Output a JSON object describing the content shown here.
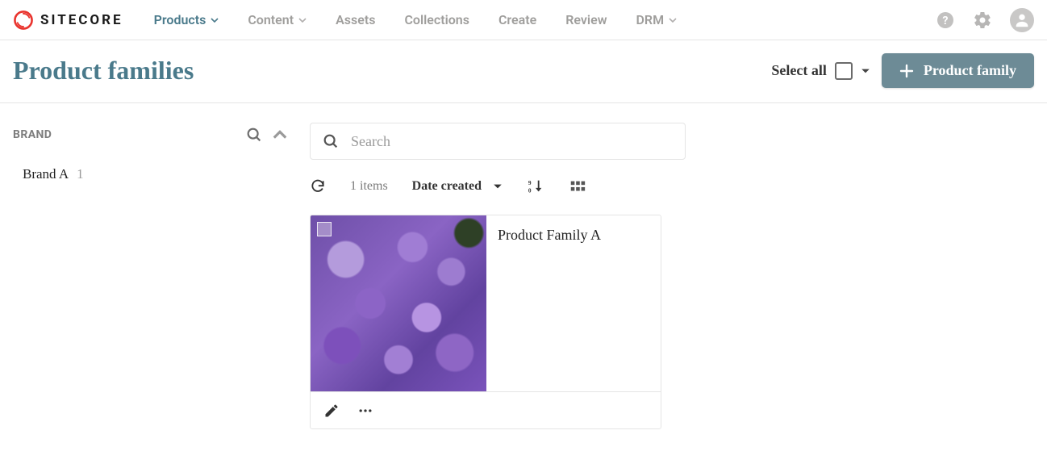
{
  "brand": {
    "word": "SITECORE"
  },
  "nav": {
    "products": "Products",
    "content": "Content",
    "assets": "Assets",
    "collections": "Collections",
    "create": "Create",
    "review": "Review",
    "drm": "DRM"
  },
  "page": {
    "title": "Product families",
    "select_all": "Select all",
    "add_button": "Product family"
  },
  "sidebar": {
    "facet_label": "BRAND",
    "items": [
      {
        "label": "Brand A",
        "count": "1"
      }
    ]
  },
  "search": {
    "placeholder": "Search"
  },
  "toolbar": {
    "count": "1 items",
    "sort_label": "Date created"
  },
  "cards": [
    {
      "title": "Product Family A"
    }
  ]
}
